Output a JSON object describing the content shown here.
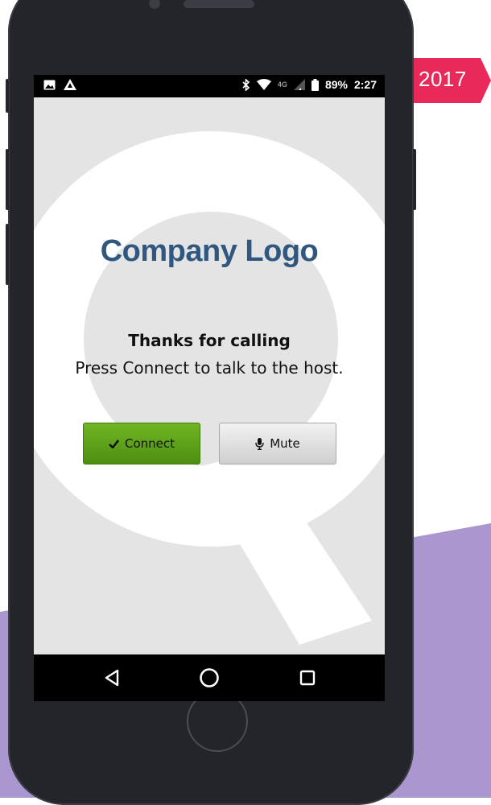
{
  "badge": {
    "year": "2017",
    "color": "#e8295a"
  },
  "status_bar": {
    "left_icons": [
      "image-icon",
      "warning-icon"
    ],
    "right_icons": [
      "bluetooth-icon",
      "wifi-icon",
      "signal-icon",
      "battery-icon"
    ],
    "network": "4G",
    "battery": "89%",
    "time": "2:27"
  },
  "app": {
    "logo_text": "Company Logo",
    "logo_color": "#2f5780",
    "message_title": "Thanks for calling",
    "message_body": "Press Connect to talk to the host.",
    "connect_label": "Connect",
    "connect_icon": "check-icon",
    "mute_label": "Mute",
    "mute_icon": "microphone-icon"
  },
  "nav_bar": {
    "items": [
      "back-icon",
      "home-icon",
      "recents-icon"
    ]
  },
  "colors": {
    "accent_green": "#5aa01a",
    "background_purple": "#ab97d0"
  }
}
